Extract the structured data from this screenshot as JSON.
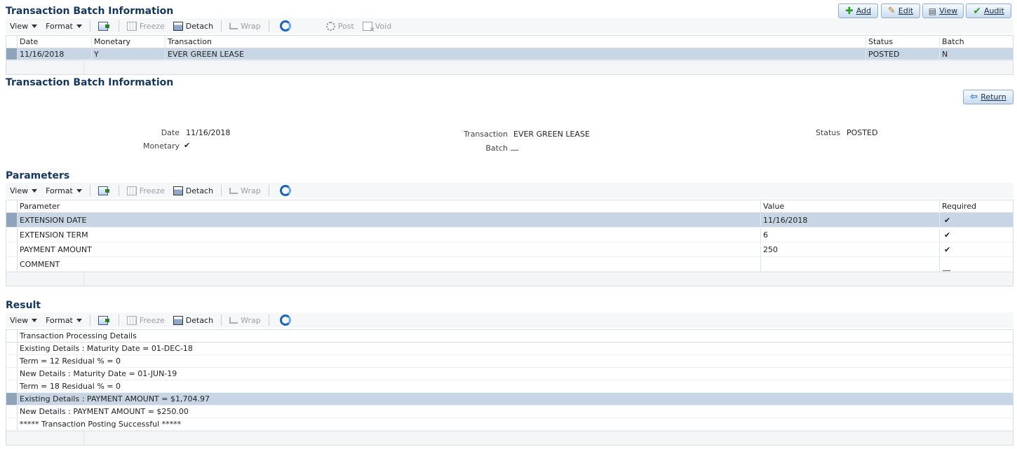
{
  "header_buttons": {
    "add": "Add",
    "edit": "Edit",
    "view": "View",
    "audit": "Audit"
  },
  "toolbar": {
    "view": "View",
    "format": "Format",
    "freeze": "Freeze",
    "detach": "Detach",
    "wrap": "Wrap",
    "post": "Post",
    "void": "Void"
  },
  "batch_grid": {
    "title": "Transaction Batch Information",
    "columns": [
      "Date",
      "Monetary",
      "Transaction",
      "Status",
      "Batch"
    ],
    "rows": [
      {
        "date": "11/16/2018",
        "monetary": "Y",
        "transaction": "EVER GREEN LEASE",
        "status": "POSTED",
        "batch": "N"
      }
    ]
  },
  "batch_detail": {
    "title": "Transaction Batch Information",
    "return_label": "Return",
    "date_label": "Date",
    "date_value": "11/16/2018",
    "monetary_label": "Monetary",
    "monetary_value": "✔",
    "transaction_label": "Transaction",
    "transaction_value": "EVER GREEN LEASE",
    "batch_label": "Batch",
    "batch_value": "__",
    "status_label": "Status",
    "status_value": "POSTED"
  },
  "parameters": {
    "title": "Parameters",
    "columns": [
      "Parameter",
      "Value",
      "Required"
    ],
    "rows": [
      {
        "parameter": "EXTENSION DATE",
        "value": "11/16/2018",
        "required": "✔"
      },
      {
        "parameter": "EXTENSION TERM",
        "value": "6",
        "required": "✔"
      },
      {
        "parameter": "PAYMENT AMOUNT",
        "value": "250",
        "required": "✔"
      },
      {
        "parameter": "COMMENT",
        "value": "",
        "required": "__"
      }
    ]
  },
  "result": {
    "title": "Result",
    "column": "Transaction Processing Details",
    "rows": [
      "Existing Details : Maturity Date = 01-DEC-18",
      "Term = 12 Residual % = 0",
      "New Details : Maturity Date = 01-JUN-19",
      "Term = 18 Residual % = 0",
      "Existing Details : PAYMENT AMOUNT = $1,704.97",
      "New Details : PAYMENT AMOUNT = $250.00",
      "***** Transaction Posting Successful *****"
    ]
  },
  "colors": {
    "title": "#16375c",
    "selected_row": "#c7d5e5",
    "button_border": "#8fa9c6"
  }
}
